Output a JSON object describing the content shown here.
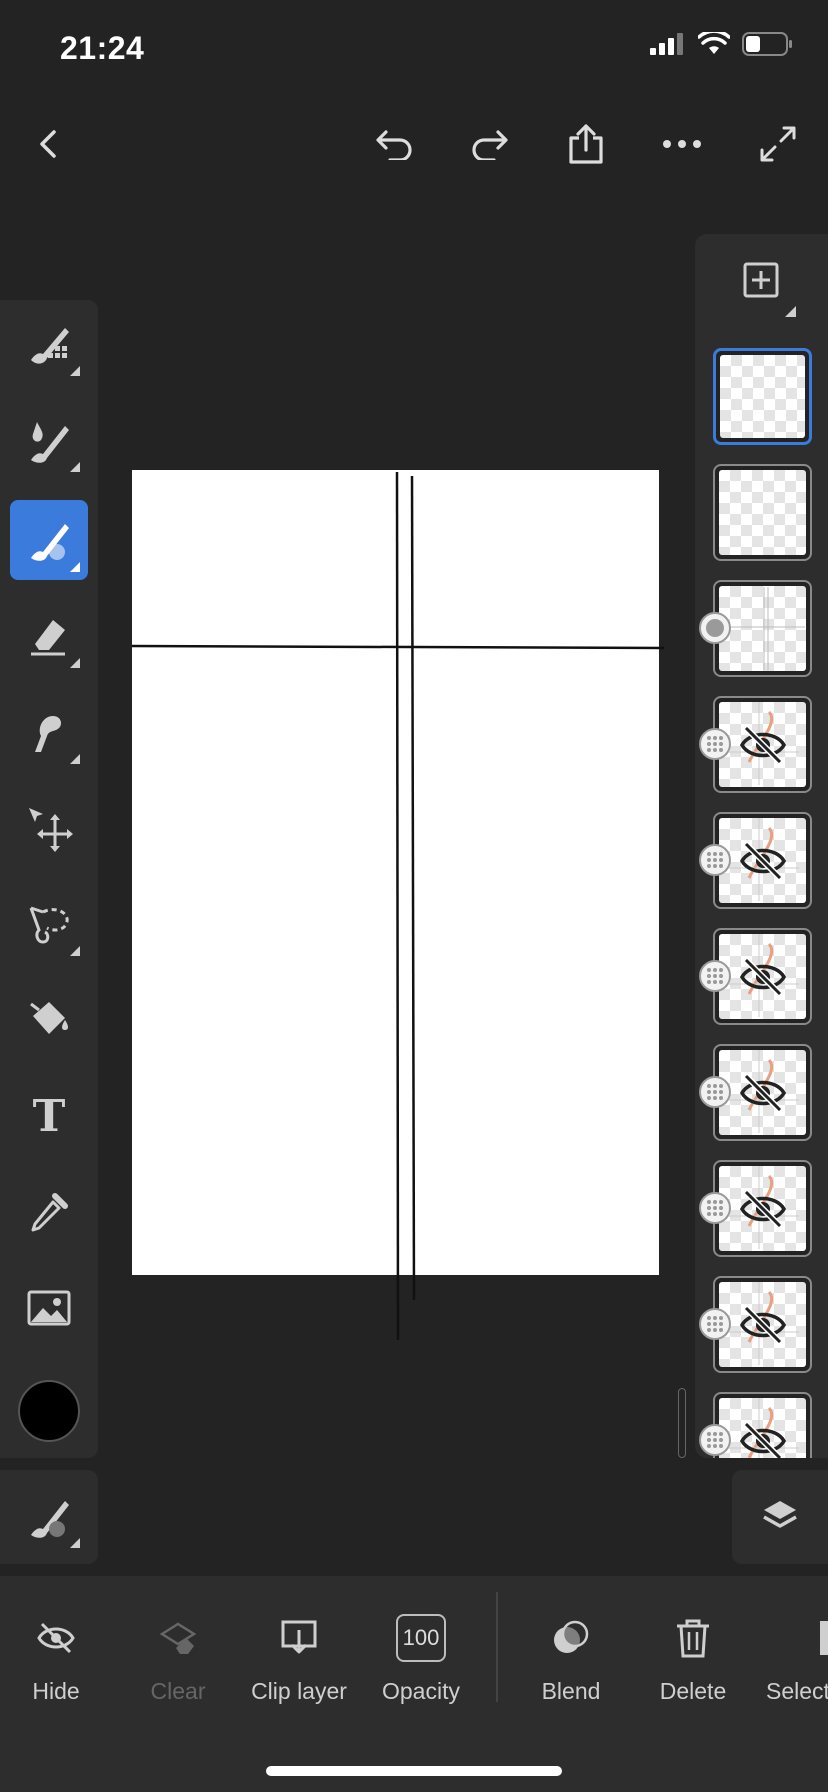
{
  "status_bar": {
    "time": "21:24"
  },
  "top_bar": {
    "icons": [
      "back-icon",
      "undo-icon",
      "redo-icon",
      "share-icon",
      "more-icon",
      "expand-icon"
    ]
  },
  "tools": [
    {
      "name": "pixel-brush",
      "icon": "pixel-brush-icon",
      "active": false
    },
    {
      "name": "watercolor-brush",
      "icon": "watercolor-brush-icon",
      "active": false
    },
    {
      "name": "live-brush",
      "icon": "live-brush-icon",
      "active": true
    },
    {
      "name": "eraser",
      "icon": "eraser-icon",
      "active": false
    },
    {
      "name": "smudge",
      "icon": "smudge-icon",
      "active": false
    },
    {
      "name": "transform",
      "icon": "transform-icon",
      "active": false
    },
    {
      "name": "lasso-select",
      "icon": "lasso-icon",
      "active": false
    },
    {
      "name": "fill",
      "icon": "fill-bucket-icon",
      "active": false
    },
    {
      "name": "text",
      "icon": "text-icon",
      "active": false
    },
    {
      "name": "eyedropper",
      "icon": "eyedropper-icon",
      "active": false
    },
    {
      "name": "image",
      "icon": "image-icon",
      "active": false
    }
  ],
  "current_color": "#000000",
  "accent_color": "#3a7bdc",
  "text_tool_glyph": "T",
  "layers": [
    {
      "type": "empty",
      "selected": true,
      "hidden": false
    },
    {
      "type": "empty",
      "selected": false,
      "hidden": false
    },
    {
      "type": "guides",
      "selected": false,
      "hidden": false
    },
    {
      "type": "sketch",
      "selected": false,
      "hidden": true
    },
    {
      "type": "sketch",
      "selected": false,
      "hidden": true
    },
    {
      "type": "sketch",
      "selected": false,
      "hidden": true
    },
    {
      "type": "sketch",
      "selected": false,
      "hidden": true
    },
    {
      "type": "sketch",
      "selected": false,
      "hidden": true
    },
    {
      "type": "sketch",
      "selected": false,
      "hidden": true
    },
    {
      "type": "sketch",
      "selected": false,
      "hidden": true
    }
  ],
  "actions": {
    "hide": "Hide",
    "clear": "Clear",
    "clip_layer": "Clip layer",
    "opacity_label": "Opacity",
    "opacity_value": "100",
    "blend": "Blend",
    "delete": "Delete",
    "select": "Select"
  }
}
